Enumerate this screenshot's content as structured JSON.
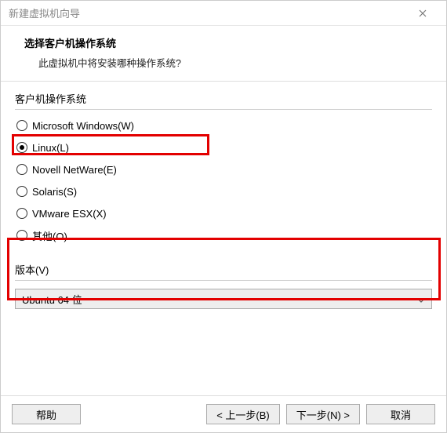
{
  "window": {
    "title": "新建虚拟机向导"
  },
  "header": {
    "title": "选择客户机操作系统",
    "subtitle": "此虚拟机中将安装哪种操作系统?"
  },
  "os_group": {
    "label": "客户机操作系统",
    "options": [
      {
        "label": "Microsoft Windows(W)",
        "selected": false
      },
      {
        "label": "Linux(L)",
        "selected": true
      },
      {
        "label": "Novell NetWare(E)",
        "selected": false
      },
      {
        "label": "Solaris(S)",
        "selected": false
      },
      {
        "label": "VMware ESX(X)",
        "selected": false
      },
      {
        "label": "其他(O)",
        "selected": false
      }
    ]
  },
  "version_group": {
    "label": "版本(V)",
    "selected": "Ubuntu 64 位"
  },
  "footer": {
    "help": "帮助",
    "back": "< 上一步(B)",
    "next": "下一步(N) >",
    "cancel": "取消"
  },
  "highlight_color": "#e30000"
}
